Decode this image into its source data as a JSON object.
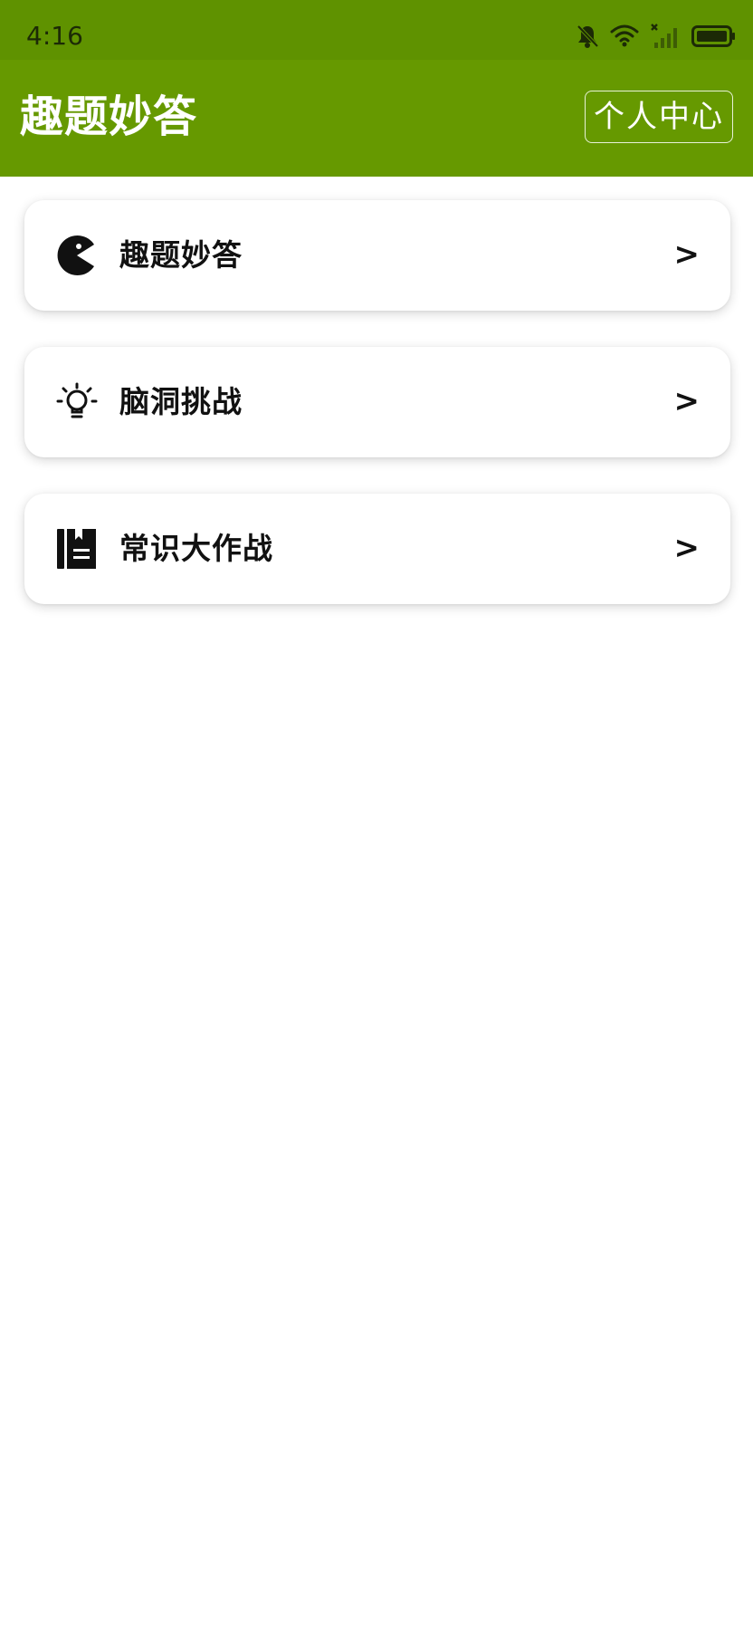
{
  "status_bar": {
    "time": "4:16",
    "icons": [
      "bell-off-icon",
      "wifi-icon",
      "signal-icon",
      "battery-icon"
    ],
    "background_color": "#5f9200"
  },
  "app_bar": {
    "title": "趣题妙答",
    "profile_button_label": "个人中心",
    "background_color": "#669900"
  },
  "menu": {
    "items": [
      {
        "label": "趣题妙答",
        "icon": "pacman-icon",
        "arrow": ">"
      },
      {
        "label": "脑洞挑战",
        "icon": "lightbulb-icon",
        "arrow": ">"
      },
      {
        "label": "常识大作战",
        "icon": "book-icon",
        "arrow": ">"
      }
    ]
  }
}
